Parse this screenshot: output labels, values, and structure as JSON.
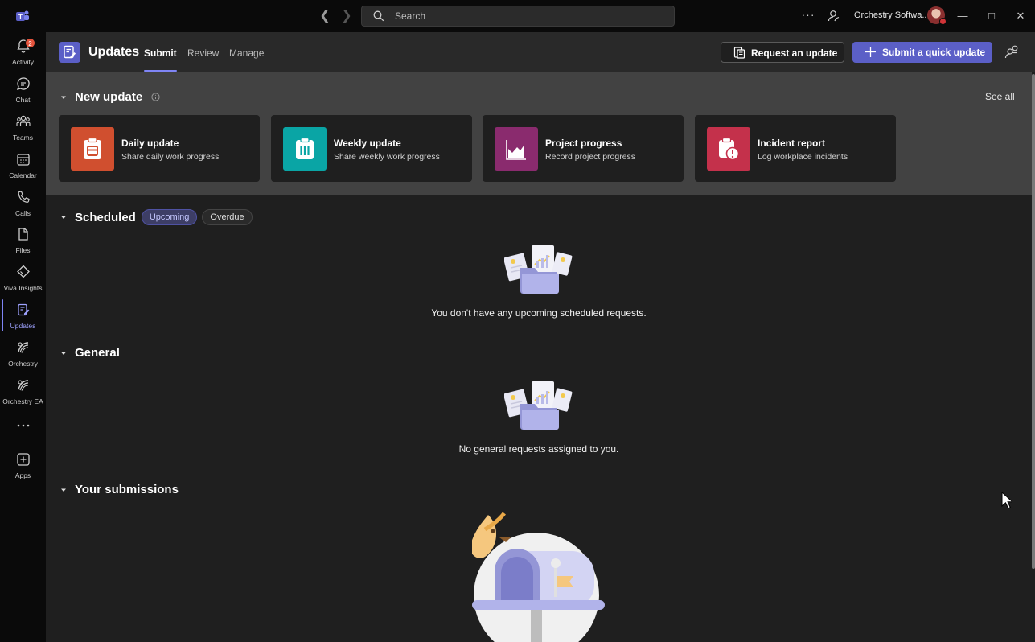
{
  "titlebar": {
    "search_placeholder": "Search",
    "more_label": "···",
    "org_name": "Orchestry Softwa...",
    "window_controls": {
      "minimize": "—",
      "maximize": "□",
      "close": "✕"
    }
  },
  "rail": {
    "items": [
      {
        "label": "Activity",
        "icon": "bell-icon",
        "badge": "2"
      },
      {
        "label": "Chat",
        "icon": "chat-icon"
      },
      {
        "label": "Teams",
        "icon": "teams-icon"
      },
      {
        "label": "Calendar",
        "icon": "calendar-icon"
      },
      {
        "label": "Calls",
        "icon": "phone-icon"
      },
      {
        "label": "Files",
        "icon": "file-icon"
      },
      {
        "label": "Viva Insights",
        "icon": "insights-icon"
      },
      {
        "label": "Updates",
        "icon": "updates-icon",
        "active": true
      },
      {
        "label": "Orchestry",
        "icon": "orchestry-icon"
      },
      {
        "label": "Orchestry EA",
        "icon": "orchestry-ea-icon"
      },
      {
        "label": "",
        "icon": "more-icon"
      },
      {
        "label": "Apps",
        "icon": "apps-icon"
      }
    ]
  },
  "header": {
    "title": "Updates",
    "tabs": [
      {
        "label": "Submit",
        "active": true
      },
      {
        "label": "Review"
      },
      {
        "label": "Manage"
      }
    ],
    "request_button": "Request an update",
    "quick_button": "Submit a quick update"
  },
  "new_update": {
    "title": "New update",
    "see_all": "See all",
    "cards": [
      {
        "title": "Daily update",
        "subtitle": "Share daily work progress",
        "color": "#d04f2f",
        "icon": "clipboard-icon"
      },
      {
        "title": "Weekly update",
        "subtitle": "Share weekly work progress",
        "color": "#0aa5a5",
        "icon": "checklist-icon"
      },
      {
        "title": "Project progress",
        "subtitle": "Record project progress",
        "color": "#8a2b6e",
        "icon": "area-chart-icon"
      },
      {
        "title": "Incident report",
        "subtitle": "Log workplace incidents",
        "color": "#c4314b",
        "icon": "alert-clipboard-icon"
      }
    ]
  },
  "scheduled": {
    "title": "Scheduled",
    "filters": [
      {
        "label": "Upcoming",
        "active": true
      },
      {
        "label": "Overdue"
      }
    ],
    "empty_text": "You don't have any upcoming scheduled requests."
  },
  "general": {
    "title": "General",
    "empty_text": "No general requests assigned to you."
  },
  "submissions": {
    "title": "Your submissions"
  },
  "colors": {
    "accent": "#5b5fc7",
    "accent_light": "#7f85f5",
    "badge": "#e5533c"
  }
}
